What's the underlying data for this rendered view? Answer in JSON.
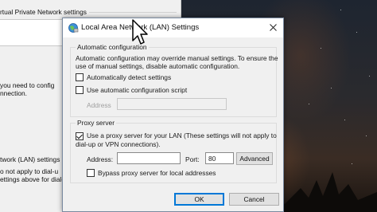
{
  "background_window": {
    "vpn_settings_label": "rtual Private Network settings",
    "paragraph_1": [
      "you need to config",
      "nnection."
    ],
    "lan_label": "twork (LAN) settings",
    "paragraph_2": [
      "o not apply to dial-u",
      "ettings above for dial-up"
    ]
  },
  "dialog": {
    "title": "Local Area Network (LAN) Settings",
    "close_icon": "close-icon",
    "automatic_configuration": {
      "group_title": "Automatic configuration",
      "description_line1": "Automatic configuration may override manual settings.  To ensure the",
      "description_line2": "use of manual settings, disable automatic configuration.",
      "auto_detect_label": "Automatically detect settings",
      "auto_detect_checked": false,
      "use_script_label": "Use automatic configuration script",
      "use_script_checked": false,
      "address_label": "Address",
      "address_value": ""
    },
    "proxy_server": {
      "group_title": "Proxy server",
      "use_proxy_label_line1": "Use a proxy server for your LAN (These settings will not apply to",
      "use_proxy_label_line2": "dial-up or VPN connections).",
      "use_proxy_checked": true,
      "address_label": "Address:",
      "address_value": "",
      "port_label": "Port:",
      "port_value": "80",
      "advanced_label": "Advanced",
      "bypass_label": "Bypass proxy server for local addresses",
      "bypass_checked": false
    },
    "ok_label": "OK",
    "cancel_label": "Cancel"
  },
  "colors": {
    "dialog_background": "#f0f0f0",
    "default_button_accent": "#0078d7"
  }
}
